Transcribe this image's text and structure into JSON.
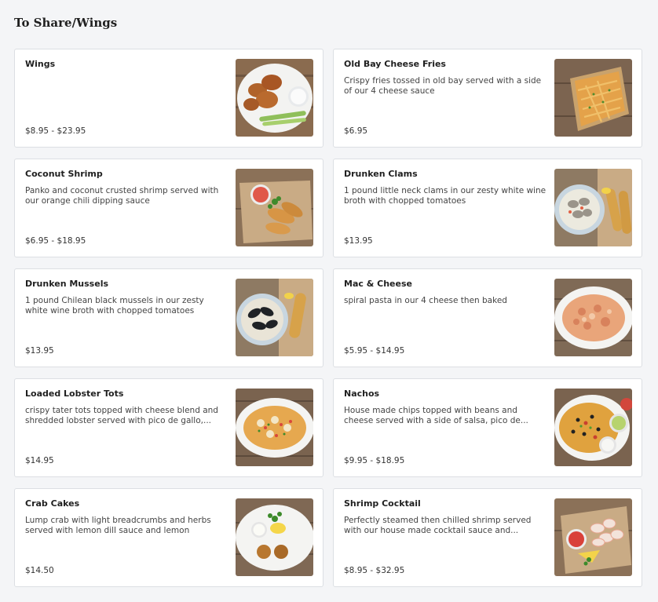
{
  "section": {
    "title": "To Share/Wings"
  },
  "items": [
    {
      "name": "Wings",
      "desc": "",
      "price": "$8.95 - $23.95",
      "image": "wings-photo"
    },
    {
      "name": "Old Bay Cheese Fries",
      "desc": "Crispy fries tossed in old bay served with a side of our 4 cheese sauce",
      "price": "$6.95",
      "image": "fries-photo"
    },
    {
      "name": "Coconut Shrimp",
      "desc": "Panko and coconut crusted shrimp served with our orange chili dipping sauce",
      "price": "$6.95 - $18.95",
      "image": "coconut-shrimp-photo"
    },
    {
      "name": "Drunken Clams",
      "desc": "1 pound little neck clams in our zesty white wine broth with chopped tomatoes",
      "price": "$13.95",
      "image": "clams-photo"
    },
    {
      "name": "Drunken Mussels",
      "desc": "1 pound Chilean black mussels in our zesty white wine broth with chopped tomatoes",
      "price": "$13.95",
      "image": "mussels-photo"
    },
    {
      "name": "Mac & Cheese",
      "desc": "spiral pasta in our 4 cheese then baked",
      "price": "$5.95 - $14.95",
      "image": "mac-cheese-photo"
    },
    {
      "name": "Loaded Lobster Tots",
      "desc": "crispy tater tots topped with cheese blend and shredded lobster served with pico de gallo,...",
      "price": "$14.95",
      "image": "lobster-tots-photo"
    },
    {
      "name": "Nachos",
      "desc": "House made chips topped with beans and cheese served with a side of salsa, pico de...",
      "price": "$9.95 - $18.95",
      "image": "nachos-photo"
    },
    {
      "name": "Crab Cakes",
      "desc": "Lump crab with light breadcrumbs and herbs served with lemon dill sauce and lemon",
      "price": "$14.50",
      "image": "crab-cakes-photo"
    },
    {
      "name": "Shrimp Cocktail",
      "desc": "Perfectly steamed then chilled shrimp served with our house made cocktail sauce and...",
      "price": "$8.95 - $32.95",
      "image": "shrimp-cocktail-photo"
    }
  ]
}
